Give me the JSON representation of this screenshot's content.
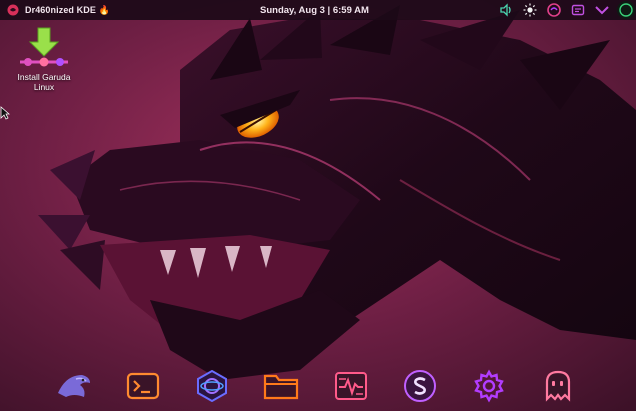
{
  "panel": {
    "title": "Dr460nized KDE",
    "title_emoji": "🔥",
    "clock": "Sunday, Aug 3 | 6:59 AM",
    "tray_icons": [
      "speaker-icon",
      "brightness-icon",
      "garuda-updater-icon",
      "clipboard-icon",
      "chevron-down-icon",
      "power-icon"
    ]
  },
  "desktop": {
    "icons": [
      {
        "label_line1": "Install Garuda",
        "label_line2": "Linux",
        "icon": "download-arrow-icon"
      }
    ]
  },
  "dock": {
    "items": [
      {
        "name": "garuda-launcher",
        "icon": "eagle-icon"
      },
      {
        "name": "terminal",
        "icon": "terminal-icon"
      },
      {
        "name": "browser",
        "icon": "browser-icon"
      },
      {
        "name": "file-manager",
        "icon": "folder-icon"
      },
      {
        "name": "system-monitor",
        "icon": "activity-icon"
      },
      {
        "name": "software-store",
        "icon": "store-icon"
      },
      {
        "name": "settings",
        "icon": "gear-icon"
      },
      {
        "name": "ghost-app",
        "icon": "ghost-icon"
      }
    ]
  },
  "colors": {
    "panel_bg": "#1c0a18",
    "accent_pink": "#e0408a",
    "accent_purple": "#b23cff",
    "accent_orange": "#ff7a1a",
    "dragon_eye": "#ffb31a"
  }
}
